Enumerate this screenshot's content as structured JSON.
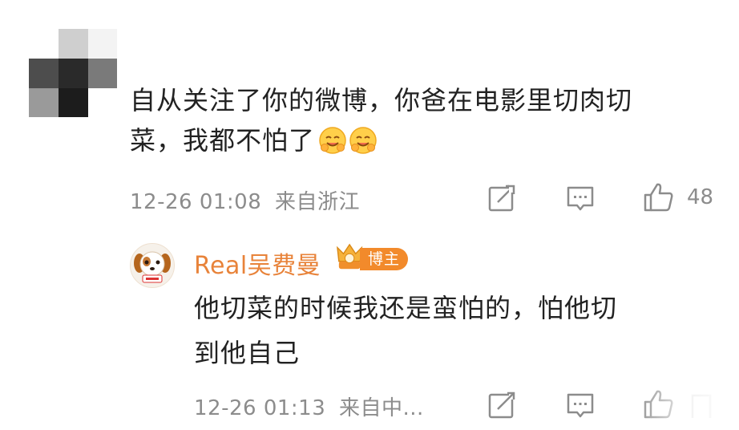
{
  "comment": {
    "text_line1": "自从关注了你的微博，你爸在电影里切肉切",
    "text_line2": "菜，我都不怕了",
    "emoji": [
      "hug-emoji",
      "hug-emoji"
    ],
    "time": "12-26 01:08",
    "location": "来自浙江",
    "like_count": "48"
  },
  "reply": {
    "author": "Real吴费曼",
    "badge": "博主",
    "text_line1": "他切菜的时候我还是蛮怕的，怕他切",
    "text_line2": "到他自己",
    "time": "12-26 01:13",
    "location": "来自中..."
  },
  "colors": {
    "author_name": "#e8833a",
    "badge": "#f28a2b",
    "meta_text": "#8c8c8c",
    "body_text": "#222222"
  },
  "icons": [
    "share-icon",
    "comment-icon",
    "like-icon"
  ]
}
